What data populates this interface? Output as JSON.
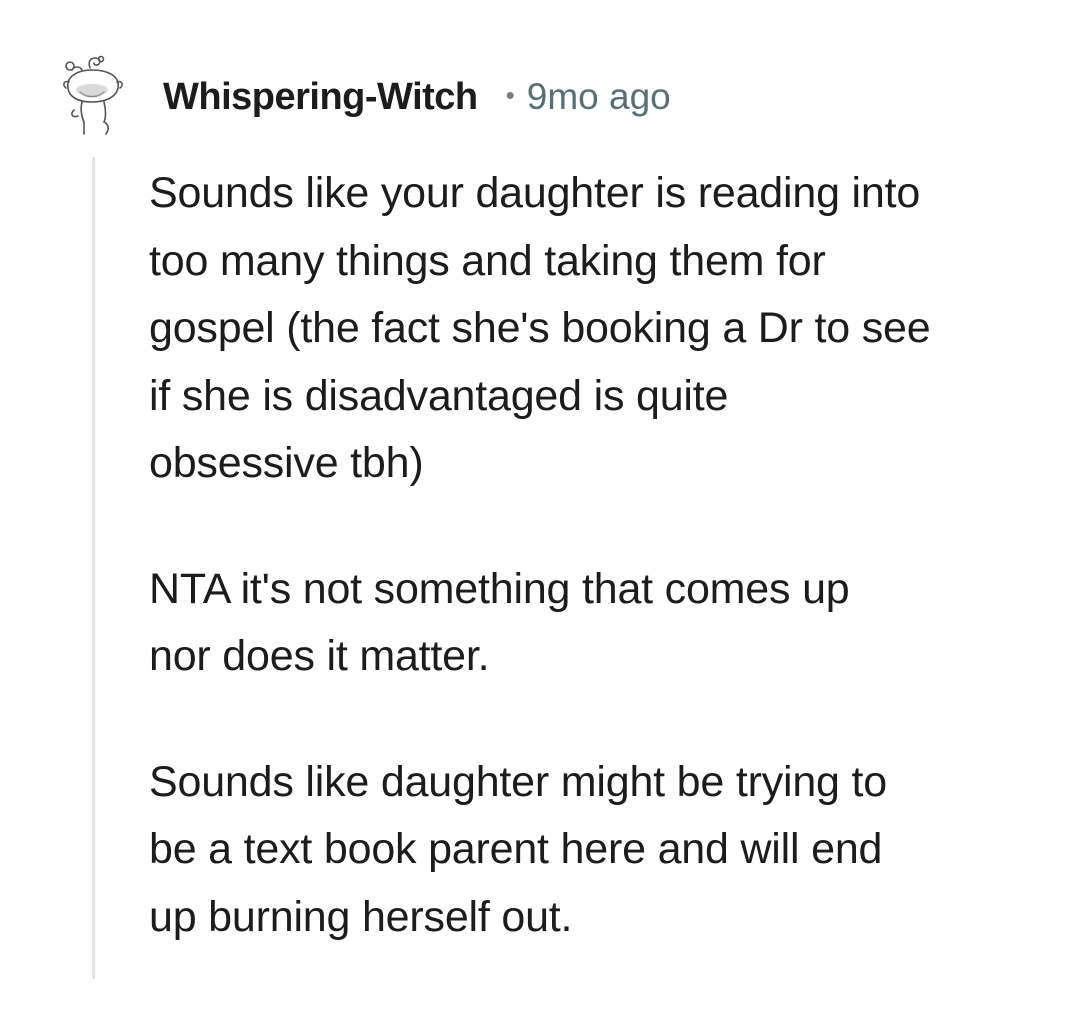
{
  "comment": {
    "username": "Whispering-Witch",
    "separator": "•",
    "timestamp": "9mo ago",
    "paragraphs": [
      [
        "Sounds like your daughter is reading into",
        "too many things and taking them for",
        "gospel (the fact she's booking a Dr to see",
        "if she is disadvantaged is quite",
        "obsessive tbh)"
      ],
      [
        "NTA it's not something that comes up",
        "nor does it matter."
      ],
      [
        "Sounds like daughter might be trying to",
        "be a text book parent here and will end",
        "up burning herself out."
      ]
    ]
  },
  "icons": {
    "avatar": "snoo-avatar-icon"
  },
  "colors": {
    "text": "#1c1c1c",
    "meta": "#576f76",
    "thread_line": "#e5e5e5",
    "background": "#ffffff"
  }
}
